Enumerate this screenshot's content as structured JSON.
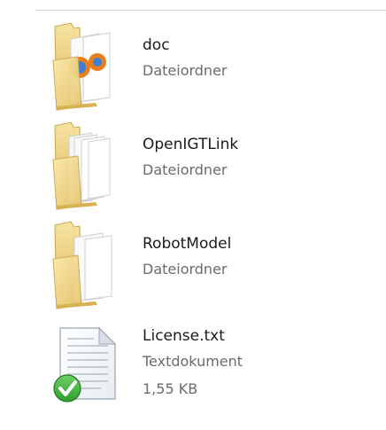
{
  "items": [
    {
      "name": "doc",
      "type": "Dateiordner",
      "icon": "folder-icon"
    },
    {
      "name": "OpenIGTLink",
      "type": "Dateiordner",
      "icon": "folder-icon"
    },
    {
      "name": "RobotModel",
      "type": "Dateiordner",
      "icon": "folder-icon"
    },
    {
      "name": "License.txt",
      "type": "Textdokument",
      "size": "1,55 KB",
      "icon": "text-file-icon",
      "overlay": "checkmark-icon"
    }
  ],
  "colors": {
    "folder_back": "#e5c66b",
    "folder_front": "#f3dc8c",
    "folder_edge": "#c9a44a",
    "check_green": "#2e9d2b",
    "name_text": "#1a1a1a",
    "sub_text": "#6b6b6b"
  }
}
